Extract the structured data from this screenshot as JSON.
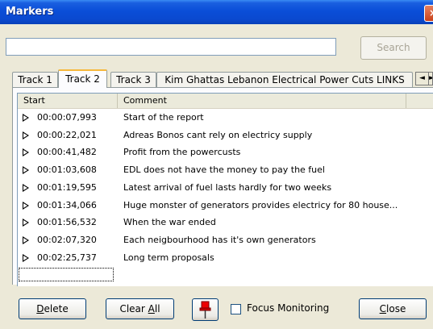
{
  "window": {
    "title": "Markers",
    "close_label": "×"
  },
  "search": {
    "value": "",
    "placeholder": "",
    "button_label": "Search"
  },
  "tabs": [
    {
      "label": "Track 1"
    },
    {
      "label": "Track 2"
    },
    {
      "label": "Track 3"
    },
    {
      "label": "Kim Ghattas Lebanon Electrical Power Cuts LINKS"
    }
  ],
  "tab_scroll": {
    "left": "◄",
    "right": "►"
  },
  "list": {
    "columns": [
      "Start",
      "Comment"
    ],
    "rows": [
      {
        "start": "00:00:07,993",
        "comment": "Start of the report"
      },
      {
        "start": "00:00:22,021",
        "comment": "Adreas Bonos cant rely on electricy supply"
      },
      {
        "start": "00:00:41,482",
        "comment": "Profit from the powercusts"
      },
      {
        "start": "00:01:03,608",
        "comment": "EDL does not have the money to pay the fuel"
      },
      {
        "start": "00:01:19,595",
        "comment": "Latest arrival of fuel lasts hardly for two weeks"
      },
      {
        "start": "00:01:34,066",
        "comment": "Huge monster of generators provides electricy for 80 house..."
      },
      {
        "start": "00:01:56,532",
        "comment": "When the war ended"
      },
      {
        "start": "00:02:07,320",
        "comment": "Each neigbourhood has it's own generators"
      },
      {
        "start": "00:02:25,737",
        "comment": "Long term proposals"
      }
    ]
  },
  "bottom": {
    "delete_label": "Delete",
    "clear_all_label": "Clear All",
    "focus_label": "Focus Monitoring",
    "focus_checked": false,
    "close_label": "Close"
  }
}
